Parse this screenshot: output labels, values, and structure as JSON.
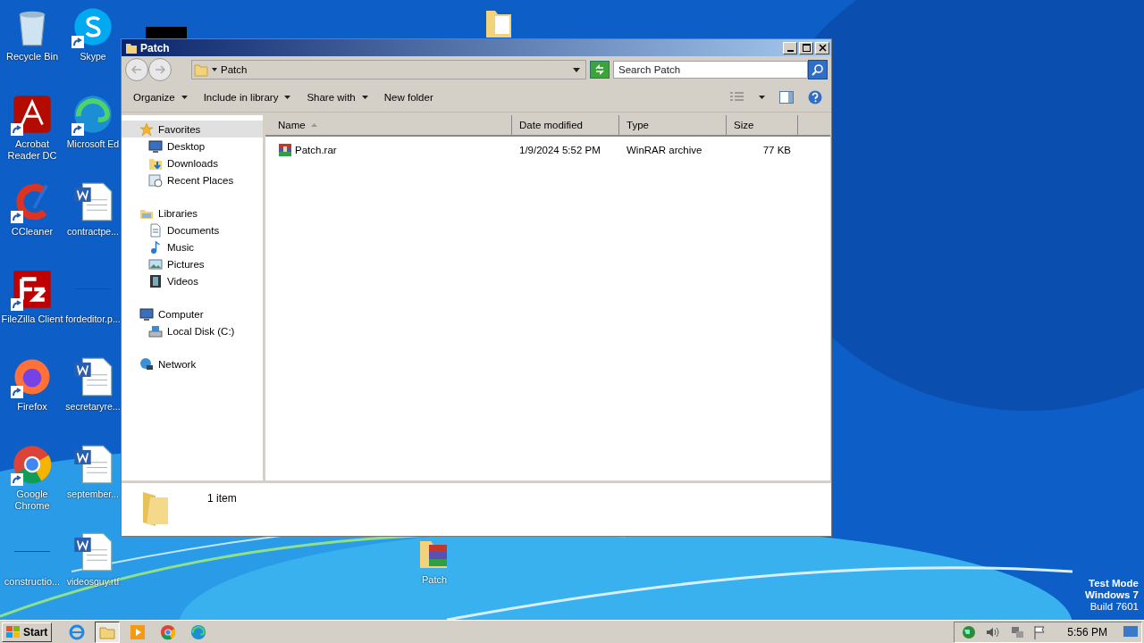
{
  "desktop": {
    "icons": [
      {
        "label": "Recycle Bin",
        "kind": "recycle-bin",
        "shortcut": false
      },
      {
        "label": "Acrobat Reader DC",
        "kind": "acrobat",
        "shortcut": true
      },
      {
        "label": "CCleaner",
        "kind": "ccleaner",
        "shortcut": true
      },
      {
        "label": "FileZilla Client",
        "kind": "filezilla",
        "shortcut": true
      },
      {
        "label": "Firefox",
        "kind": "firefox",
        "shortcut": true
      },
      {
        "label": "Google Chrome",
        "kind": "chrome",
        "shortcut": true
      },
      {
        "label": "constructio...",
        "kind": "blank",
        "shortcut": false
      },
      {
        "label": "Skype",
        "kind": "skype",
        "shortcut": true
      },
      {
        "label": "Microsoft Ed",
        "kind": "edge",
        "shortcut": true
      },
      {
        "label": "contractpe...",
        "kind": "word",
        "shortcut": false
      },
      {
        "label": "fordeditor.p...",
        "kind": "blank",
        "shortcut": false
      },
      {
        "label": "secretaryre...",
        "kind": "word",
        "shortcut": false
      },
      {
        "label": "september...",
        "kind": "word",
        "shortcut": false
      },
      {
        "label": "videosguy.rtf",
        "kind": "word",
        "shortcut": false
      }
    ],
    "extra_icon": {
      "label": "Patch",
      "kind": "archive-folder"
    },
    "watermark_text": [
      "Test Mode",
      "Windows 7",
      "Build 7601"
    ]
  },
  "window": {
    "title": "Patch",
    "address": "Patch",
    "search": {
      "placeholder": "Search Patch"
    },
    "toolbar": [
      {
        "label": "Organize",
        "dropdown": true
      },
      {
        "label": "Include in library",
        "dropdown": true
      },
      {
        "label": "Share with",
        "dropdown": true
      },
      {
        "label": "New folder",
        "dropdown": false
      }
    ],
    "sidebar": [
      {
        "label": "Favorites",
        "kind": "star",
        "selected": true,
        "children": [
          {
            "label": "Desktop",
            "kind": "desktop",
            "selected": false
          },
          {
            "label": "Downloads",
            "kind": "downloads",
            "selected": false
          },
          {
            "label": "Recent Places",
            "kind": "recent",
            "selected": false
          }
        ]
      },
      {
        "label": "Libraries",
        "kind": "libraries",
        "selected": false,
        "children": [
          {
            "label": "Documents",
            "kind": "documents",
            "selected": false
          },
          {
            "label": "Music",
            "kind": "music",
            "selected": false
          },
          {
            "label": "Pictures",
            "kind": "pictures",
            "selected": false
          },
          {
            "label": "Videos",
            "kind": "videos",
            "selected": false
          }
        ]
      },
      {
        "label": "Computer",
        "kind": "computer",
        "selected": false,
        "children": [
          {
            "label": "Local Disk (C:)",
            "kind": "disk",
            "selected": false
          }
        ]
      },
      {
        "label": "Network",
        "kind": "network",
        "selected": false
      }
    ],
    "table": {
      "columns": [
        {
          "label": "Name",
          "sorted": true
        },
        {
          "label": "Date modified",
          "sorted": false
        },
        {
          "label": "Type",
          "sorted": false
        },
        {
          "label": "Size",
          "sorted": false
        }
      ],
      "rows": [
        {
          "name": "Patch.rar",
          "date": "1/9/2024 5:52 PM",
          "type": "WinRAR archive",
          "size": "77 KB",
          "selected": false
        }
      ]
    },
    "details": {
      "text": "1 item"
    }
  },
  "taskbar": {
    "start": "Start",
    "apps": [
      {
        "kind": "ie",
        "selected": false
      },
      {
        "kind": "explorer",
        "selected": true
      },
      {
        "kind": "media",
        "selected": false
      },
      {
        "kind": "chrome",
        "selected": false
      },
      {
        "kind": "edge",
        "selected": false
      }
    ],
    "clock": "5:56 PM"
  }
}
